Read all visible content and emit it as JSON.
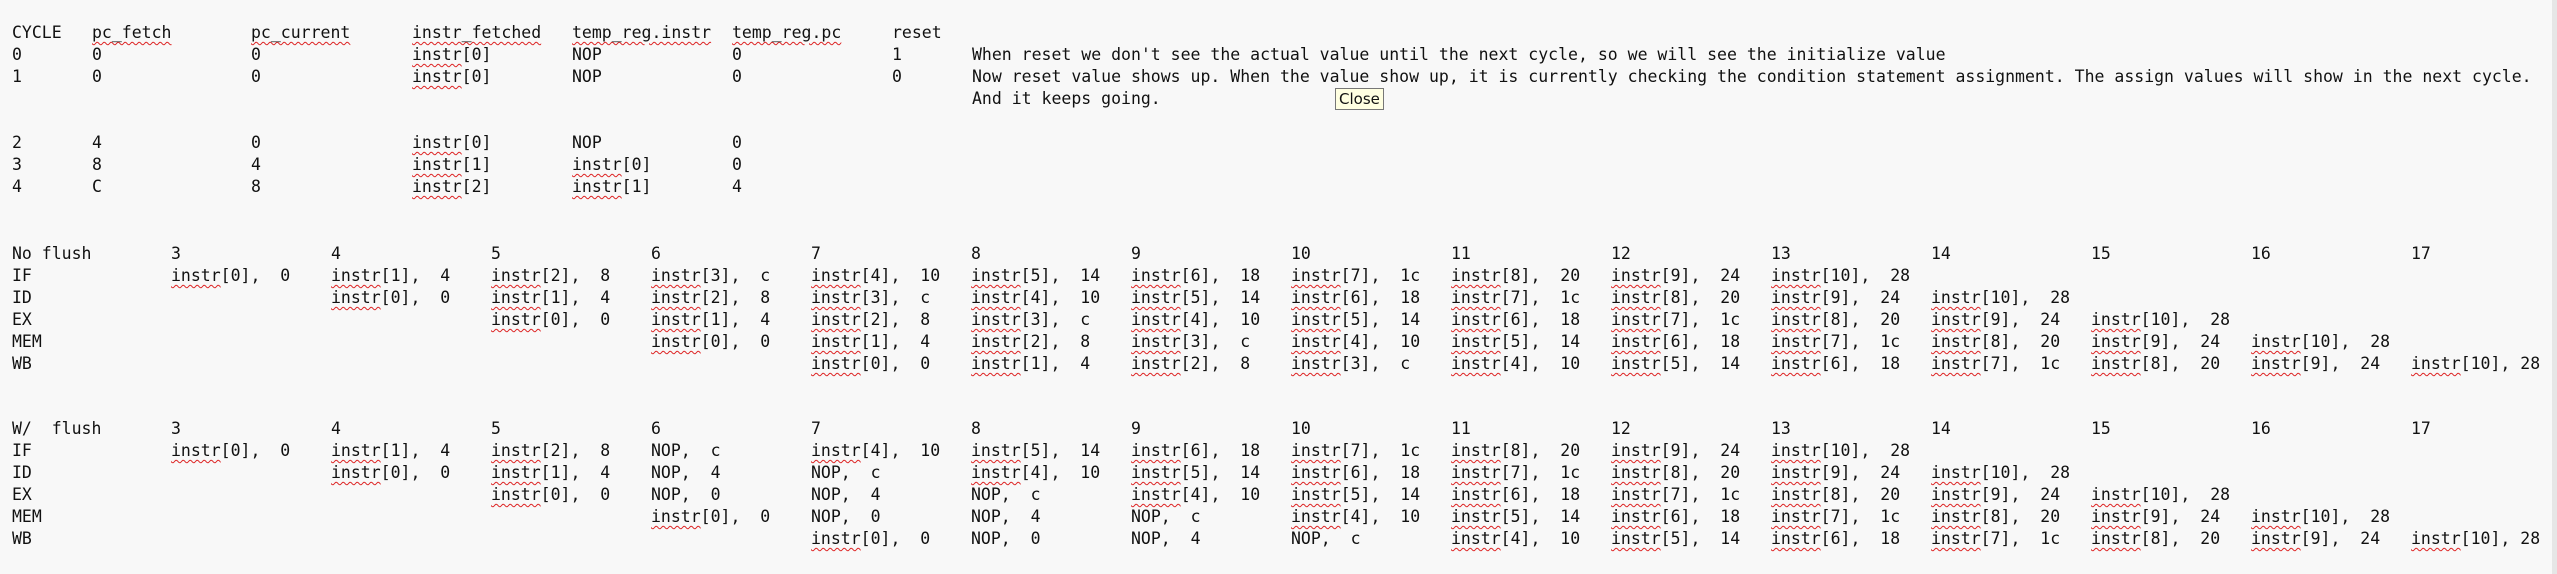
{
  "top_table": {
    "headers": [
      "CYCLE",
      "pc_fetch",
      "pc_current",
      "instr_fetched",
      "temp_reg.instr",
      "temp_reg.pc",
      "reset"
    ],
    "rows": [
      [
        "0",
        "0",
        "0",
        "instr[0]",
        "NOP",
        "0",
        "1"
      ],
      [
        "1",
        "0",
        "0",
        "instr[0]",
        "NOP",
        "0",
        "0"
      ],
      [
        "2",
        "4",
        "0",
        "instr[0]",
        "NOP",
        "0",
        ""
      ],
      [
        "3",
        "8",
        "4",
        "instr[1]",
        "instr[0]",
        "0",
        ""
      ],
      [
        "4",
        "C",
        "8",
        "instr[2]",
        "instr[1]",
        "4",
        ""
      ]
    ],
    "notes": [
      "When reset we don't see the actual value until the next cycle, so we will see the initialize value",
      "Now reset value shows up. When the value show up, it is currently checking the condition statement assignment. The assign values will show in the next cycle.",
      "And it keeps going."
    ]
  },
  "tooltip": "Close",
  "no_flush": {
    "title": "No flush",
    "cycles": [
      "3",
      "4",
      "5",
      "6",
      "7",
      "8",
      "9",
      "10",
      "11",
      "12",
      "13",
      "14",
      "15",
      "16",
      "17"
    ],
    "stages": [
      {
        "name": "IF",
        "cells": [
          "instr[0],  0",
          "instr[1],  4",
          "instr[2],  8",
          "instr[3],  c",
          "instr[4],  10",
          "instr[5],  14",
          "instr[6],  18",
          "instr[7],  1c",
          "instr[8],  20",
          "instr[9],  24",
          "instr[10],  28",
          "",
          "",
          "",
          ""
        ]
      },
      {
        "name": "ID",
        "cells": [
          "",
          "instr[0],  0",
          "instr[1],  4",
          "instr[2],  8",
          "instr[3],  c",
          "instr[4],  10",
          "instr[5],  14",
          "instr[6],  18",
          "instr[7],  1c",
          "instr[8],  20",
          "instr[9],  24",
          "instr[10],  28",
          "",
          "",
          ""
        ]
      },
      {
        "name": "EX",
        "cells": [
          "",
          "",
          "instr[0],  0",
          "instr[1],  4",
          "instr[2],  8",
          "instr[3],  c",
          "instr[4],  10",
          "instr[5],  14",
          "instr[6],  18",
          "instr[7],  1c",
          "instr[8],  20",
          "instr[9],  24",
          "instr[10],  28",
          "",
          ""
        ]
      },
      {
        "name": "MEM",
        "cells": [
          "",
          "",
          "",
          "instr[0],  0",
          "instr[1],  4",
          "instr[2],  8",
          "instr[3],  c",
          "instr[4],  10",
          "instr[5],  14",
          "instr[6],  18",
          "instr[7],  1c",
          "instr[8],  20",
          "instr[9],  24",
          "instr[10],  28",
          ""
        ]
      },
      {
        "name": "WB",
        "cells": [
          "",
          "",
          "",
          "",
          "instr[0],  0",
          "instr[1],  4",
          "instr[2],  8",
          "instr[3],  c",
          "instr[4],  10",
          "instr[5],  14",
          "instr[6],  18",
          "instr[7],  1c",
          "instr[8],  20",
          "instr[9],  24",
          "instr[10], 28"
        ]
      }
    ]
  },
  "with_flush": {
    "title": "W/  flush",
    "cycles": [
      "3",
      "4",
      "5",
      "6",
      "7",
      "8",
      "9",
      "10",
      "11",
      "12",
      "13",
      "14",
      "15",
      "16",
      "17"
    ],
    "stages": [
      {
        "name": "IF",
        "cells": [
          "instr[0],  0",
          "instr[1],  4",
          "instr[2],  8",
          "NOP,  c",
          "instr[4],  10",
          "instr[5],  14",
          "instr[6],  18",
          "instr[7],  1c",
          "instr[8],  20",
          "instr[9],  24",
          "instr[10],  28",
          "",
          "",
          "",
          ""
        ]
      },
      {
        "name": "ID",
        "cells": [
          "",
          "instr[0],  0",
          "instr[1],  4",
          "NOP,  4",
          "NOP,  c",
          "instr[4],  10",
          "instr[5],  14",
          "instr[6],  18",
          "instr[7],  1c",
          "instr[8],  20",
          "instr[9],  24",
          "instr[10],  28",
          "",
          "",
          ""
        ]
      },
      {
        "name": "EX",
        "cells": [
          "",
          "",
          "instr[0],  0",
          "NOP,  0",
          "NOP,  4",
          "NOP,  c",
          "instr[4],  10",
          "instr[5],  14",
          "instr[6],  18",
          "instr[7],  1c",
          "instr[8],  20",
          "instr[9],  24",
          "instr[10],  28",
          "",
          ""
        ]
      },
      {
        "name": "MEM",
        "cells": [
          "",
          "",
          "",
          "instr[0],  0",
          "NOP,  0",
          "NOP,  4",
          "NOP,  c",
          "instr[4],  10",
          "instr[5],  14",
          "instr[6],  18",
          "instr[7],  1c",
          "instr[8],  20",
          "instr[9],  24",
          "instr[10],  28",
          ""
        ]
      },
      {
        "name": "WB",
        "cells": [
          "",
          "",
          "",
          "",
          "instr[0],  0",
          "NOP,  0",
          "NOP,  4",
          "NOP,  c",
          "instr[4],  10",
          "instr[5],  14",
          "instr[6],  18",
          "instr[7],  1c",
          "instr[8],  20",
          "instr[9],  24",
          "instr[10], 28"
        ]
      }
    ]
  }
}
